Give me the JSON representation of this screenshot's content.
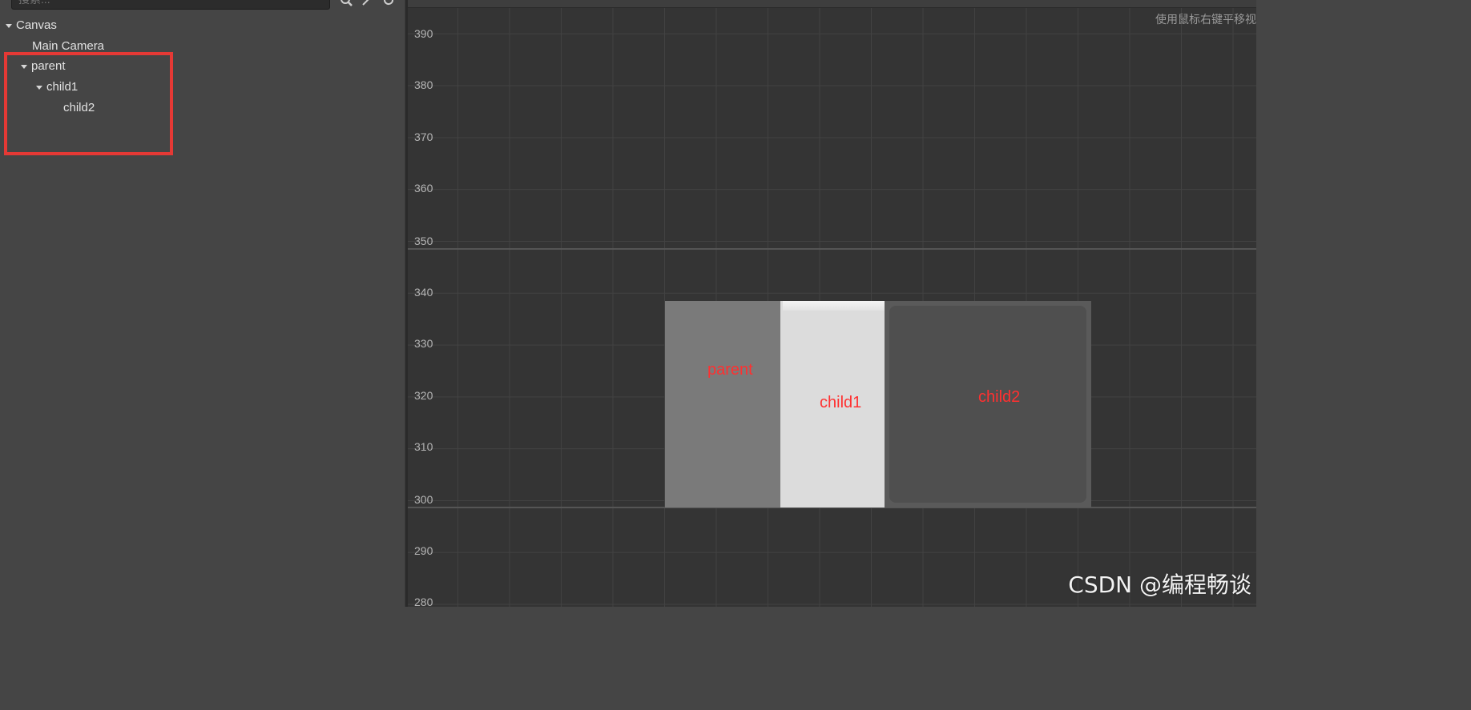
{
  "hierarchy": {
    "search_placeholder": "搜索...",
    "toolbar_icons": [
      "search-icon",
      "locate-icon",
      "refresh-icon"
    ],
    "tree": {
      "canvas": "Canvas",
      "main_camera": "Main Camera",
      "parent": "parent",
      "child1": "child1",
      "child2": "child2"
    },
    "highlight_color": "#e53935"
  },
  "scene": {
    "hint": "使用鼠标右键平移视",
    "y_ticks": [
      "390",
      "380",
      "370",
      "360",
      "350",
      "340",
      "330",
      "320",
      "310",
      "300",
      "290",
      "280"
    ],
    "nodes": {
      "parent_label": "parent",
      "child1_label": "child1",
      "child2_label": "child2"
    },
    "colors": {
      "parent": "#7a7a7a",
      "child1": "#dcdcdc",
      "child2": "#555555",
      "label": "#ff3030"
    }
  },
  "watermark": "CSDN @编程畅谈"
}
